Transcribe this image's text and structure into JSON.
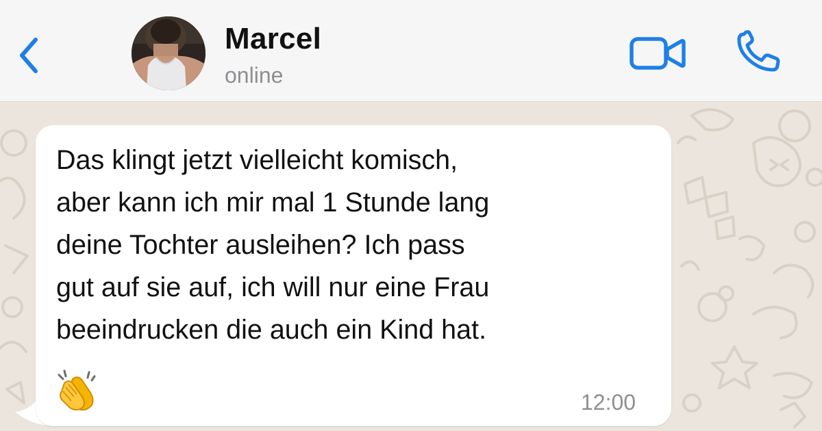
{
  "header": {
    "contact_name": "Marcel",
    "status": "online",
    "back_icon": "chevron-left-icon",
    "video_icon": "video-camera-icon",
    "call_icon": "phone-icon",
    "accent_color": "#1f7fe6"
  },
  "chat": {
    "background_color": "#ece5dd",
    "messages": [
      {
        "direction": "incoming",
        "text": "Das klingt jetzt vielleicht komisch,\naber kann ich mir mal 1 Stunde lang\ndeine Tochter ausleihen? Ich pass\ngut auf sie auf, ich will nur eine Frau\nbeeindrucken die auch ein Kind hat.",
        "emoji": "clapping-hands-emoji",
        "time": "12:00"
      }
    ]
  }
}
